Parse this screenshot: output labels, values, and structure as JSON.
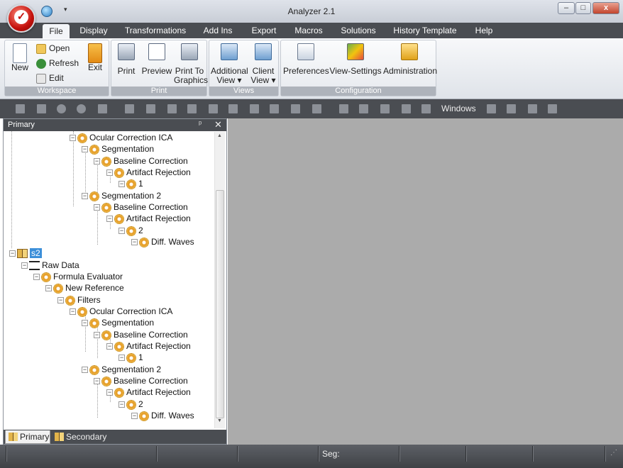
{
  "app": {
    "title": "Analyzer 2.1"
  },
  "window_controls": {
    "minimize": "–",
    "maximize": "□",
    "close": "x"
  },
  "menu": [
    "File",
    "Display",
    "Transformations",
    "Add Ins",
    "Export",
    "Macros",
    "Solutions",
    "History Template",
    "Help"
  ],
  "ribbon": {
    "workspace": {
      "label": "Workspace",
      "new": "New",
      "open": "Open",
      "refresh": "Refresh",
      "edit": "Edit",
      "exit": "Exit"
    },
    "print": {
      "label": "Print",
      "print": "Print",
      "preview": "Preview",
      "print_to_graphics_1": "Print To",
      "print_to_graphics_2": "Graphics"
    },
    "views": {
      "label": "Views",
      "additional_1": "Additional",
      "additional_2": "View",
      "client_1": "Client",
      "client_2": "View",
      "dropdown": "▾"
    },
    "configuration": {
      "label": "Configuration",
      "preferences": "Preferences",
      "view_settings": "View-Settings",
      "administration": "Administration"
    }
  },
  "toolbar": {
    "windows_label": "Windows"
  },
  "panel": {
    "title": "Primary",
    "pin": "ᵖ",
    "close": "✕",
    "tree": [
      {
        "label": "Ocular Correction ICA",
        "icon": "gear"
      },
      {
        "label": "Segmentation",
        "icon": "gear"
      },
      {
        "label": "Baseline Correction",
        "icon": "gear"
      },
      {
        "label": "Artifact Rejection",
        "icon": "gear"
      },
      {
        "label": "1",
        "icon": "gear"
      },
      {
        "label": "Segmentation 2",
        "icon": "gear"
      },
      {
        "label": "Baseline Correction",
        "icon": "gear"
      },
      {
        "label": "Artifact Rejection",
        "icon": "gear"
      },
      {
        "label": "2",
        "icon": "gear"
      },
      {
        "label": "Diff. Waves",
        "icon": "gear"
      },
      {
        "label": "s2",
        "icon": "book",
        "selected": true
      },
      {
        "label": "Raw Data",
        "icon": "wave"
      },
      {
        "label": "Formula Evaluator",
        "icon": "gear"
      },
      {
        "label": "New Reference",
        "icon": "gear"
      },
      {
        "label": "Filters",
        "icon": "gear"
      },
      {
        "label": "Ocular Correction ICA",
        "icon": "gear"
      },
      {
        "label": "Segmentation",
        "icon": "gear"
      },
      {
        "label": "Baseline Correction",
        "icon": "gear"
      },
      {
        "label": "Artifact Rejection",
        "icon": "gear"
      },
      {
        "label": "1",
        "icon": "gear"
      },
      {
        "label": "Segmentation 2",
        "icon": "gear"
      },
      {
        "label": "Baseline Correction",
        "icon": "gear"
      },
      {
        "label": "Artifact Rejection",
        "icon": "gear"
      },
      {
        "label": "2",
        "icon": "gear"
      },
      {
        "label": "Diff. Waves",
        "icon": "gear"
      }
    ],
    "tabs": {
      "primary": "Primary",
      "secondary": "Secondary"
    }
  },
  "status": {
    "seg": "Seg:"
  },
  "colors": {
    "dark_bar": "#4a4d52",
    "workspace": "#ababab",
    "selection": "#3c8fd9",
    "gear": "#e7a02b"
  }
}
